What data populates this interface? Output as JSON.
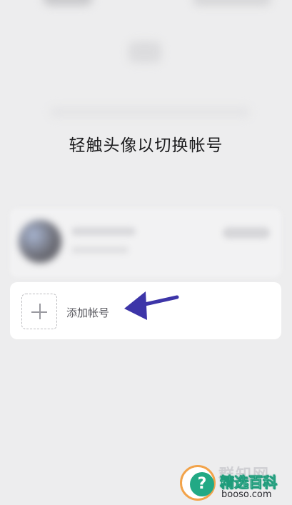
{
  "title": "轻触头像以切换帐号",
  "add_account": {
    "label": "添加帐号"
  },
  "watermark": {
    "ghost_text": "群知网",
    "brand": "精选百科",
    "site": "booso.com"
  },
  "colors": {
    "arrow": "#3d35a8",
    "background": "#ededee",
    "card": "#ffffff"
  }
}
